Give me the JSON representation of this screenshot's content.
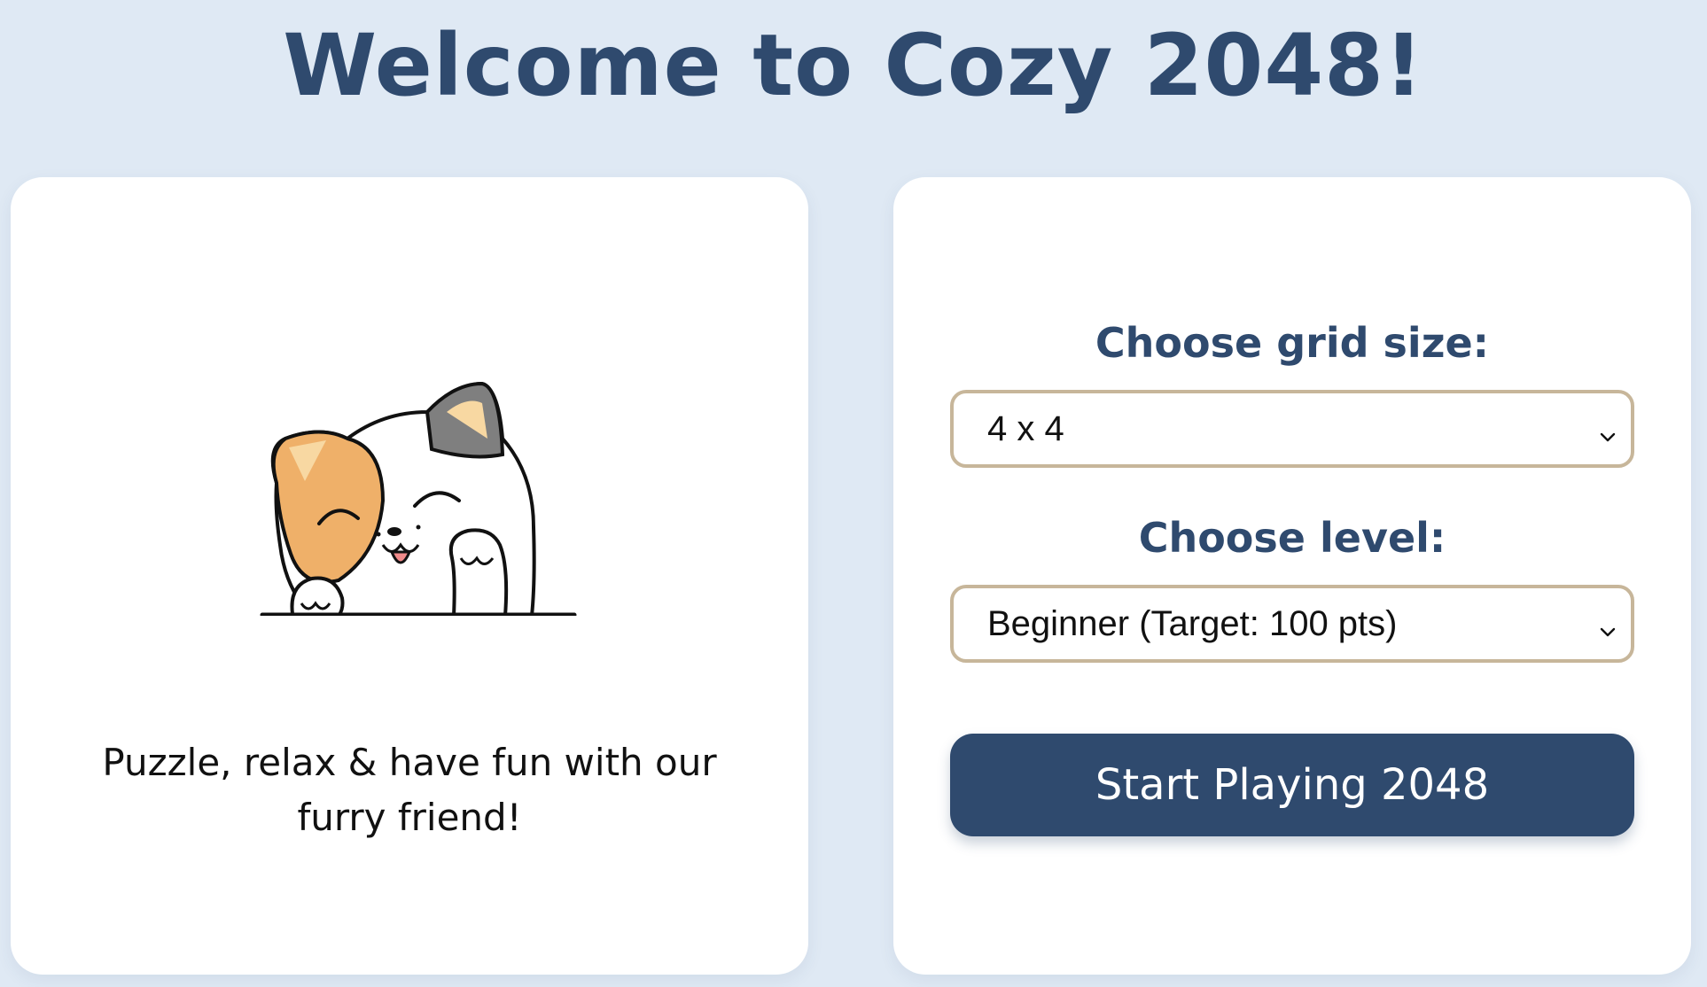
{
  "page": {
    "title": "Welcome to Cozy 2048!"
  },
  "left_card": {
    "tagline": "Puzzle, relax & have fun with our furry friend!"
  },
  "right_card": {
    "grid_label": "Choose grid size:",
    "grid_value": "4 x 4",
    "level_label": "Choose level:",
    "level_value": "Beginner (Target: 100 pts)",
    "start_button": "Start Playing 2048"
  },
  "colors": {
    "background": "#dfe9f4",
    "accent": "#2f4a6e",
    "select_border": "#c7b69a",
    "card": "#ffffff"
  },
  "icons": [
    "calico-cat-illustration",
    "chevron-down-icon"
  ]
}
